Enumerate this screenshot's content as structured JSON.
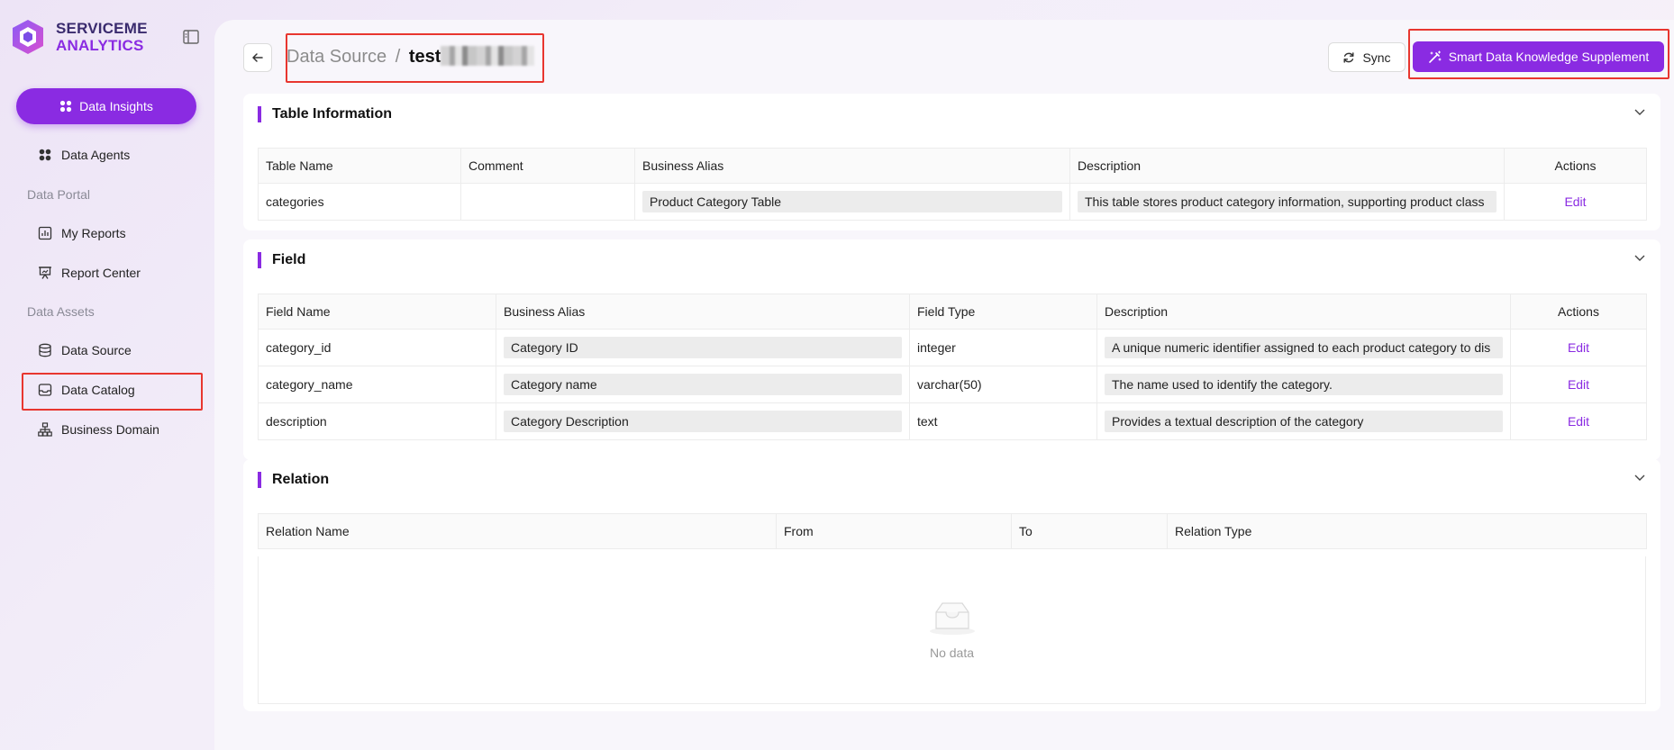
{
  "brand": {
    "line1": "SERVICEME",
    "line2": "ANALYTICS"
  },
  "sidebar": {
    "primary_label": "Data Insights",
    "data_agents": "Data Agents",
    "section_portal": "Data Portal",
    "my_reports": "My Reports",
    "report_center": "Report Center",
    "section_assets": "Data Assets",
    "data_source": "Data Source",
    "data_catalog": "Data Catalog",
    "business_domain": "Business Domain"
  },
  "header": {
    "breadcrumb_parent": "Data Source",
    "breadcrumb_sep": "/",
    "breadcrumb_current": "test",
    "sync_label": "Sync",
    "smart_label": "Smart Data Knowledge Supplement"
  },
  "table_info": {
    "title": "Table Information",
    "columns": [
      "Table Name",
      "Comment",
      "Business Alias",
      "Description",
      "Actions"
    ],
    "row": {
      "table_name": "categories",
      "comment": "",
      "business_alias": "Product Category Table",
      "description": "This table stores product category information, supporting product class",
      "action": "Edit"
    }
  },
  "field": {
    "title": "Field",
    "columns": [
      "Field Name",
      "Business Alias",
      "Field Type",
      "Description",
      "Actions"
    ],
    "rows": [
      {
        "name": "category_id",
        "alias": "Category ID",
        "type": "integer",
        "description": "A unique numeric identifier assigned to each product category to dis",
        "action": "Edit"
      },
      {
        "name": "category_name",
        "alias": "Category name",
        "type": "varchar(50)",
        "description": "The name used to identify the category.",
        "action": "Edit"
      },
      {
        "name": "description",
        "alias": "Category Description",
        "type": "text",
        "description": "Provides a textual description of the category",
        "action": "Edit"
      }
    ]
  },
  "relation": {
    "title": "Relation",
    "columns": [
      "Relation Name",
      "From",
      "To",
      "Relation Type"
    ],
    "empty_text": "No data"
  },
  "colors": {
    "accent": "#8a2be2",
    "highlight": "#e8362f"
  }
}
